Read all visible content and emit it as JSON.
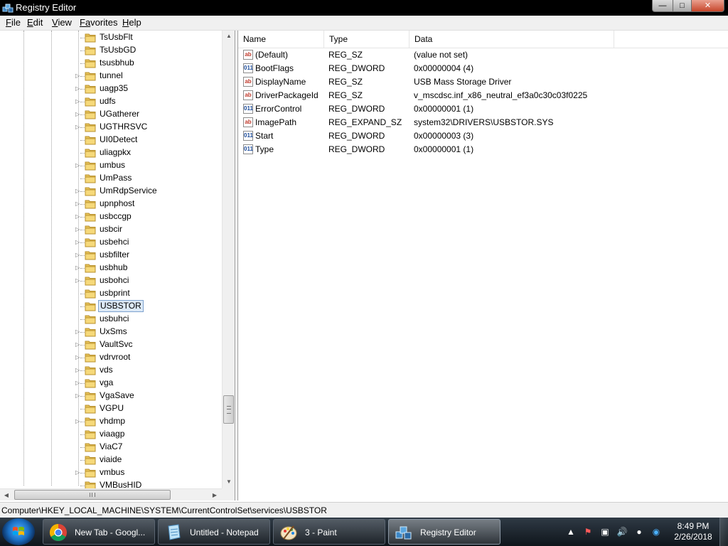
{
  "window": {
    "title": "Registry Editor",
    "controls": {
      "minimize": "—",
      "maximize": "□",
      "close": "✕"
    }
  },
  "menu": [
    {
      "label_u": "F",
      "label_rest": "ile"
    },
    {
      "label_u": "E",
      "label_rest": "dit"
    },
    {
      "label_u": "V",
      "label_rest": "iew"
    },
    {
      "label_u": "Fa",
      "label_rest": "vorites"
    },
    {
      "label_u": "H",
      "label_rest": "elp"
    }
  ],
  "tree": {
    "items": [
      {
        "label": "TsUsbFlt",
        "expandable": false
      },
      {
        "label": "TsUsbGD",
        "expandable": false
      },
      {
        "label": "tsusbhub",
        "expandable": false
      },
      {
        "label": "tunnel",
        "expandable": true
      },
      {
        "label": "uagp35",
        "expandable": true
      },
      {
        "label": "udfs",
        "expandable": true
      },
      {
        "label": "UGatherer",
        "expandable": true
      },
      {
        "label": "UGTHRSVC",
        "expandable": true
      },
      {
        "label": "UI0Detect",
        "expandable": false
      },
      {
        "label": "uliagpkx",
        "expandable": false
      },
      {
        "label": "umbus",
        "expandable": true
      },
      {
        "label": "UmPass",
        "expandable": false
      },
      {
        "label": "UmRdpService",
        "expandable": true
      },
      {
        "label": "upnphost",
        "expandable": true
      },
      {
        "label": "usbccgp",
        "expandable": true
      },
      {
        "label": "usbcir",
        "expandable": true
      },
      {
        "label": "usbehci",
        "expandable": true
      },
      {
        "label": "usbfilter",
        "expandable": true
      },
      {
        "label": "usbhub",
        "expandable": true
      },
      {
        "label": "usbohci",
        "expandable": true
      },
      {
        "label": "usbprint",
        "expandable": false
      },
      {
        "label": "USBSTOR",
        "expandable": false,
        "selected": true
      },
      {
        "label": "usbuhci",
        "expandable": false
      },
      {
        "label": "UxSms",
        "expandable": true
      },
      {
        "label": "VaultSvc",
        "expandable": true
      },
      {
        "label": "vdrvroot",
        "expandable": true
      },
      {
        "label": "vds",
        "expandable": true
      },
      {
        "label": "vga",
        "expandable": true
      },
      {
        "label": "VgaSave",
        "expandable": true
      },
      {
        "label": "VGPU",
        "expandable": false
      },
      {
        "label": "vhdmp",
        "expandable": true
      },
      {
        "label": "viaagp",
        "expandable": false
      },
      {
        "label": "ViaC7",
        "expandable": false
      },
      {
        "label": "viaide",
        "expandable": false
      },
      {
        "label": "vmbus",
        "expandable": true
      },
      {
        "label": "VMBusHID",
        "expandable": false
      }
    ],
    "hscroll_grip": "|||"
  },
  "values": {
    "columns": [
      "Name",
      "Type",
      "Data"
    ],
    "rows": [
      {
        "icon": "ab",
        "kind": "string",
        "name": "(Default)",
        "type": "REG_SZ",
        "data": "(value not set)"
      },
      {
        "icon": "011",
        "kind": "dword",
        "name": "BootFlags",
        "type": "REG_DWORD",
        "data": "0x00000004 (4)"
      },
      {
        "icon": "ab",
        "kind": "string",
        "name": "DisplayName",
        "type": "REG_SZ",
        "data": "USB Mass Storage Driver"
      },
      {
        "icon": "ab",
        "kind": "string",
        "name": "DriverPackageId",
        "type": "REG_SZ",
        "data": "v_mscdsc.inf_x86_neutral_ef3a0c30c03f0225"
      },
      {
        "icon": "011",
        "kind": "dword",
        "name": "ErrorControl",
        "type": "REG_DWORD",
        "data": "0x00000001 (1)"
      },
      {
        "icon": "ab",
        "kind": "string",
        "name": "ImagePath",
        "type": "REG_EXPAND_SZ",
        "data": "system32\\DRIVERS\\USBSTOR.SYS"
      },
      {
        "icon": "011",
        "kind": "dword",
        "name": "Start",
        "type": "REG_DWORD",
        "data": "0x00000003 (3)"
      },
      {
        "icon": "011",
        "kind": "dword",
        "name": "Type",
        "type": "REG_DWORD",
        "data": "0x00000001 (1)"
      }
    ]
  },
  "status": {
    "path": "Computer\\HKEY_LOCAL_MACHINE\\SYSTEM\\CurrentControlSet\\services\\USBSTOR"
  },
  "taskbar": {
    "tasks": [
      {
        "name": "chrome",
        "label": "New Tab - Googl...",
        "active": false
      },
      {
        "name": "notepad",
        "label": "Untitled - Notepad",
        "active": false
      },
      {
        "name": "paint",
        "label": "3 - Paint",
        "active": false
      },
      {
        "name": "regedit",
        "label": "Registry Editor",
        "active": true
      }
    ],
    "clock": {
      "time": "8:49 PM",
      "date": "2/26/2018"
    }
  },
  "colors": {
    "titlebar": "#000000",
    "selection_bg": "#dce9f7",
    "selection_border": "#7da2ce",
    "folder": "#e8c35a"
  }
}
